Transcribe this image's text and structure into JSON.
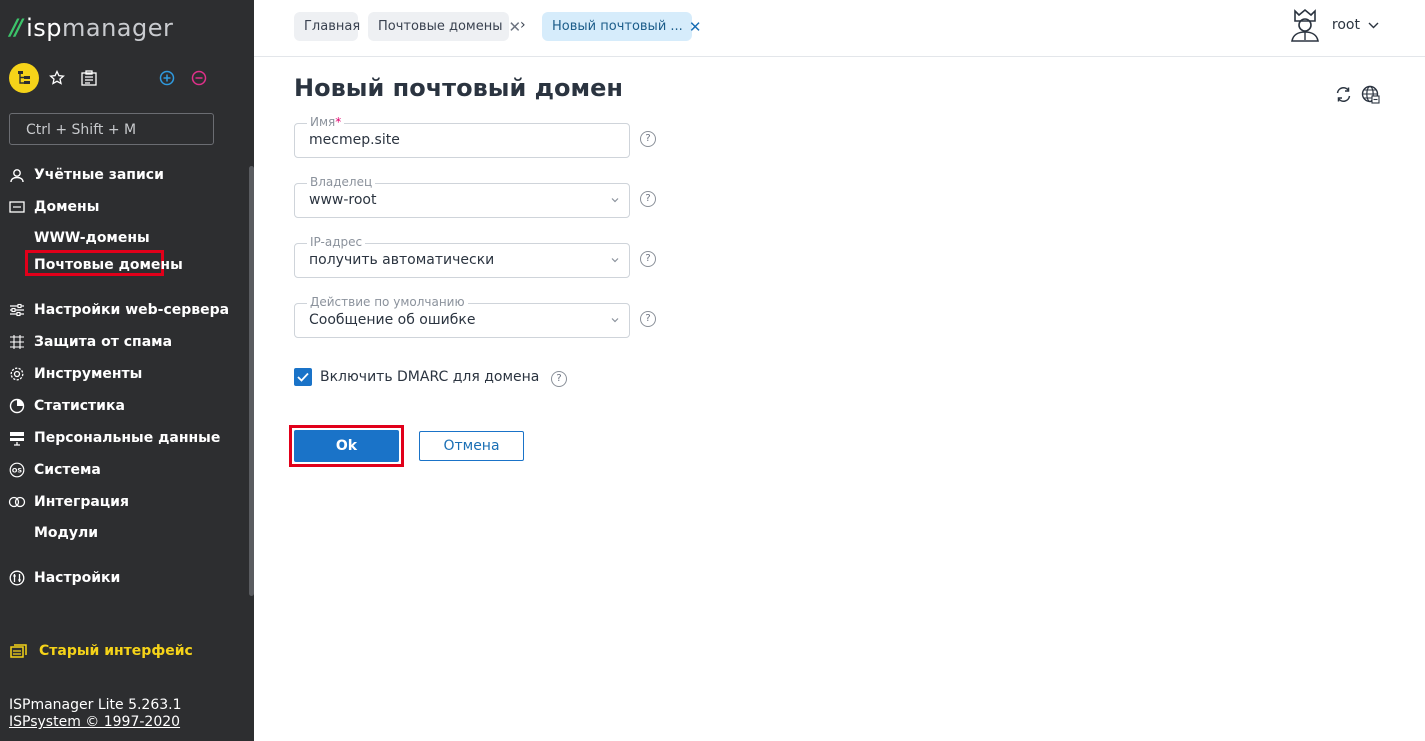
{
  "brand": {
    "mark": "//",
    "name_bold": "isp",
    "name_light": "manager"
  },
  "search": {
    "placeholder": "Ctrl + Shift + M"
  },
  "sidebar": {
    "items": [
      {
        "label": "Учётные записи",
        "icon": "users-icon"
      },
      {
        "label": "Домены",
        "icon": "domains-icon"
      },
      {
        "label": "Настройки web-сервера",
        "icon": "sliders-icon"
      },
      {
        "label": "Защита от спама",
        "icon": "spam-filter-icon"
      },
      {
        "label": "Инструменты",
        "icon": "gear-icon"
      },
      {
        "label": "Статистика",
        "icon": "pie-chart-icon"
      },
      {
        "label": "Персональные данные",
        "icon": "personal-data-icon"
      },
      {
        "label": "Система",
        "icon": "os-icon"
      },
      {
        "label": "Интеграция",
        "icon": "integration-icon"
      },
      {
        "label": "Настройки",
        "icon": "settings-icon"
      }
    ],
    "sub": {
      "www_domains": "WWW-домены",
      "mail_domains": "Почтовые домены",
      "modules": "Модули"
    },
    "old_interface": "Старый интерфейс",
    "footer": {
      "version": "ISPmanager Lite 5.263.1",
      "copyright": "ISPsystem © 1997-2020"
    }
  },
  "breadcrumbs": [
    {
      "label": "Главная"
    },
    {
      "label": "Почтовые домены"
    },
    {
      "label": "Новый почтовый ..."
    }
  ],
  "user": {
    "name": "root"
  },
  "form": {
    "title": "Новый почтовый домен",
    "name": {
      "label": "Имя",
      "required_mark": "*",
      "value": "mecmep.site"
    },
    "owner": {
      "label": "Владелец",
      "value": "www-root"
    },
    "ip": {
      "label": "IP-адрес",
      "value": "получить автоматически"
    },
    "default_action": {
      "label": "Действие по умолчанию",
      "value": "Сообщение об ошибке"
    },
    "dmarc": {
      "label": "Включить DMARC для домена",
      "checked": true
    },
    "ok_label": "Ok",
    "cancel_label": "Отмена",
    "help_glyph": "?"
  },
  "colors": {
    "sidebar_bg": "#2d2e30",
    "accent_blue": "#1a73c8",
    "highlight_red": "#e1001a",
    "brand_green": "#3cc46a",
    "brand_yellow": "#f5d319"
  }
}
